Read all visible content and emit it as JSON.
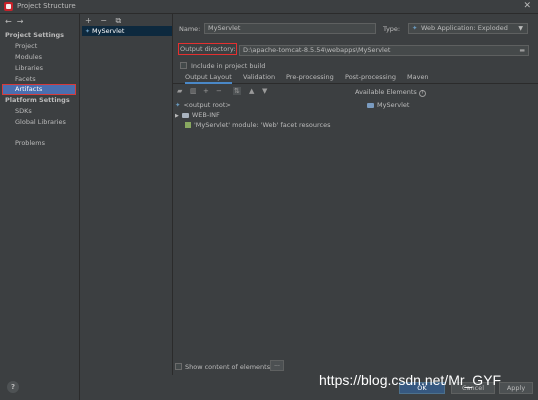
{
  "window": {
    "title": "Project Structure",
    "close_glyph": "✕"
  },
  "sidebar": {
    "nav_arrows": "←→",
    "project_settings_header": "Project Settings",
    "items": [
      "Project",
      "Modules",
      "Libraries",
      "Facets",
      "Artifacts"
    ],
    "selected_index": 4,
    "platform_settings_header": "Platform Settings",
    "platform_items": [
      "SDKs",
      "Global Libraries"
    ],
    "problems_label": "Problems",
    "help_label": "?"
  },
  "artifact_list": {
    "toolbar": [
      "+",
      "−",
      "⧉"
    ],
    "items": [
      "MyServlet"
    ]
  },
  "form": {
    "name_label": "Name:",
    "name_value": "MyServlet",
    "type_label": "Type:",
    "type_value": "Web Application: Exploded",
    "output_dir_label": "Output directory:",
    "output_dir_value": "D:\\apache-tomcat-8.5.54\\webapps\\MyServlet",
    "include_in_build_label": "Include in project build",
    "include_in_build_checked": false
  },
  "tabs": [
    "Output Layout",
    "Validation",
    "Pre-processing",
    "Post-processing",
    "Maven"
  ],
  "active_tab_index": 0,
  "layout": {
    "available_label": "Available Elements",
    "output_tree": [
      {
        "label": "<output root>",
        "icon": "globe-icon"
      },
      {
        "label": "WEB-INF",
        "icon": "folder-icon"
      },
      {
        "label": "'MyServlet' module: 'Web' facet resources",
        "icon": "facet-icon"
      }
    ],
    "available_tree": [
      {
        "label": "MyServlet",
        "icon": "module-folder-icon"
      }
    ],
    "show_content_label": "Show content of elements",
    "dots_label": "..."
  },
  "buttons": {
    "ok": "OK",
    "cancel": "Cancel",
    "apply": "Apply"
  },
  "watermark": "https://blog.csdn.net/Mr_GYF"
}
